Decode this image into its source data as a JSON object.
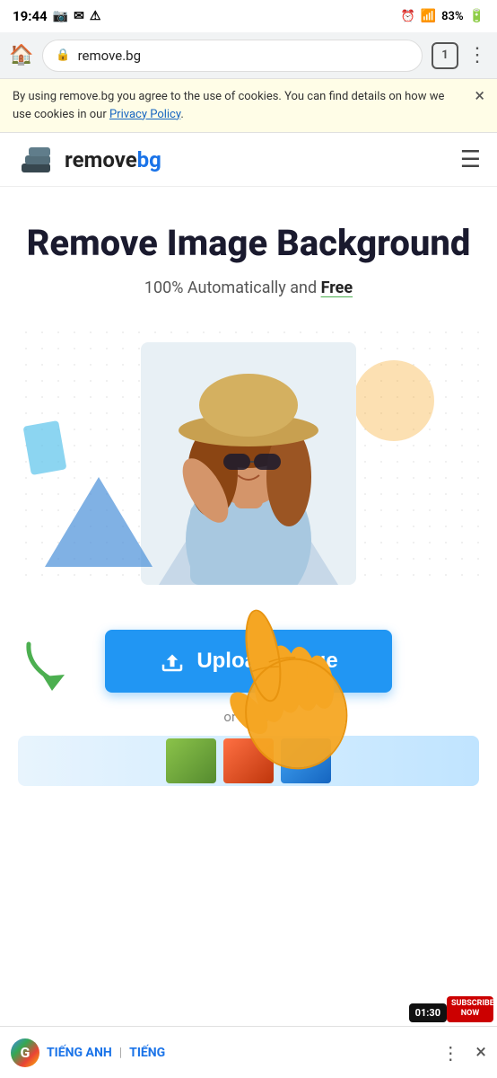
{
  "statusBar": {
    "time": "19:44",
    "batteryPercent": "83%",
    "tabCount": "1"
  },
  "addressBar": {
    "url": "remove.bg",
    "homeLabel": "🏠",
    "menuLabel": "⋮"
  },
  "cookieBanner": {
    "text": "By using remove.bg you agree to the use of cookies. You can find details on how we use cookies in our ",
    "linkText": "Privacy Policy",
    "closeLabel": "×"
  },
  "navbar": {
    "logoText1": "remove",
    "logoText2": "bg",
    "menuLabel": "☰"
  },
  "hero": {
    "title": "Remove Image Background",
    "subtitle": "100% Automatically and ",
    "freeLabel": "Free"
  },
  "uploadSection": {
    "uploadButtonLabel": "Upload Image",
    "orText": "or try on",
    "arrowSymbol": "➜"
  },
  "translateBar": {
    "gLabel": "G",
    "lang1": "TIẾNG ANH",
    "lang2": "TIẾNG",
    "moreLabel": "⋮",
    "closeLabel": "×"
  },
  "badges": {
    "subscribe": "SUBSCRIBE\nNOW",
    "timer": "01:30"
  }
}
